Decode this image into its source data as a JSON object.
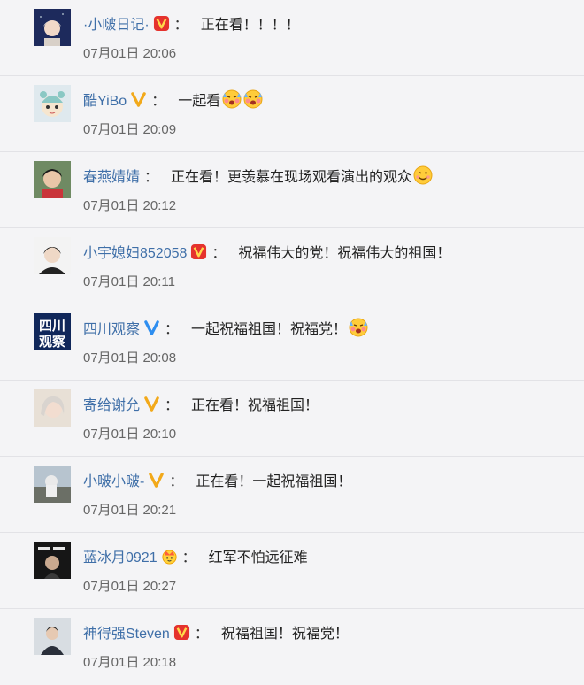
{
  "comments": [
    {
      "name": "·小啵日记·",
      "badge": "red-v-badge",
      "text": "正在看！！！！",
      "emojis": [],
      "time": "07月01日 20:06"
    },
    {
      "name": "酷YiBo",
      "badge": "gold-v-badge",
      "text": "一起看",
      "emojis": [
        "blushing-face-icon",
        "blushing-face-icon"
      ],
      "time": "07月01日 20:09"
    },
    {
      "name": "春燕婧婧",
      "badge": "",
      "text": "正在看！更羡慕在现场观看演出的观众",
      "emojis": [
        "smiling-face-icon"
      ],
      "time": "07月01日 20:12"
    },
    {
      "name": "小宇媳妇852058",
      "badge": "red-v-badge",
      "text": "祝福伟大的党！祝福伟大的祖国！",
      "emojis": [],
      "time": "07月01日 20:11"
    },
    {
      "name": "四川观察",
      "badge": "blue-v-badge",
      "text": "一起祝福祖国！祝福党！",
      "emojis": [
        "blushing-face-icon"
      ],
      "time": "07月01日 20:08"
    },
    {
      "name": "寄给谢允",
      "badge": "gold-v-badge",
      "text": "正在看！祝福祖国！",
      "emojis": [],
      "time": "07月01日 20:10"
    },
    {
      "name": "小啵小啵-",
      "badge": "gold-v-badge",
      "text": "正在看！一起祝福祖国！",
      "emojis": [],
      "time": "07月01日 20:21"
    },
    {
      "name": "蓝冰月0921",
      "badge": "crown-badge",
      "text": "红军不怕远征难",
      "emojis": [],
      "time": "07月01日 20:27"
    },
    {
      "name": "神得强Steven",
      "badge": "red-v-badge",
      "text": "祝福祖国！祝福党！",
      "emojis": [],
      "time": "07月01日 20:18"
    }
  ],
  "avatar_badge_text": {
    "line1": "四川",
    "line2": "观察"
  },
  "colon": "："
}
